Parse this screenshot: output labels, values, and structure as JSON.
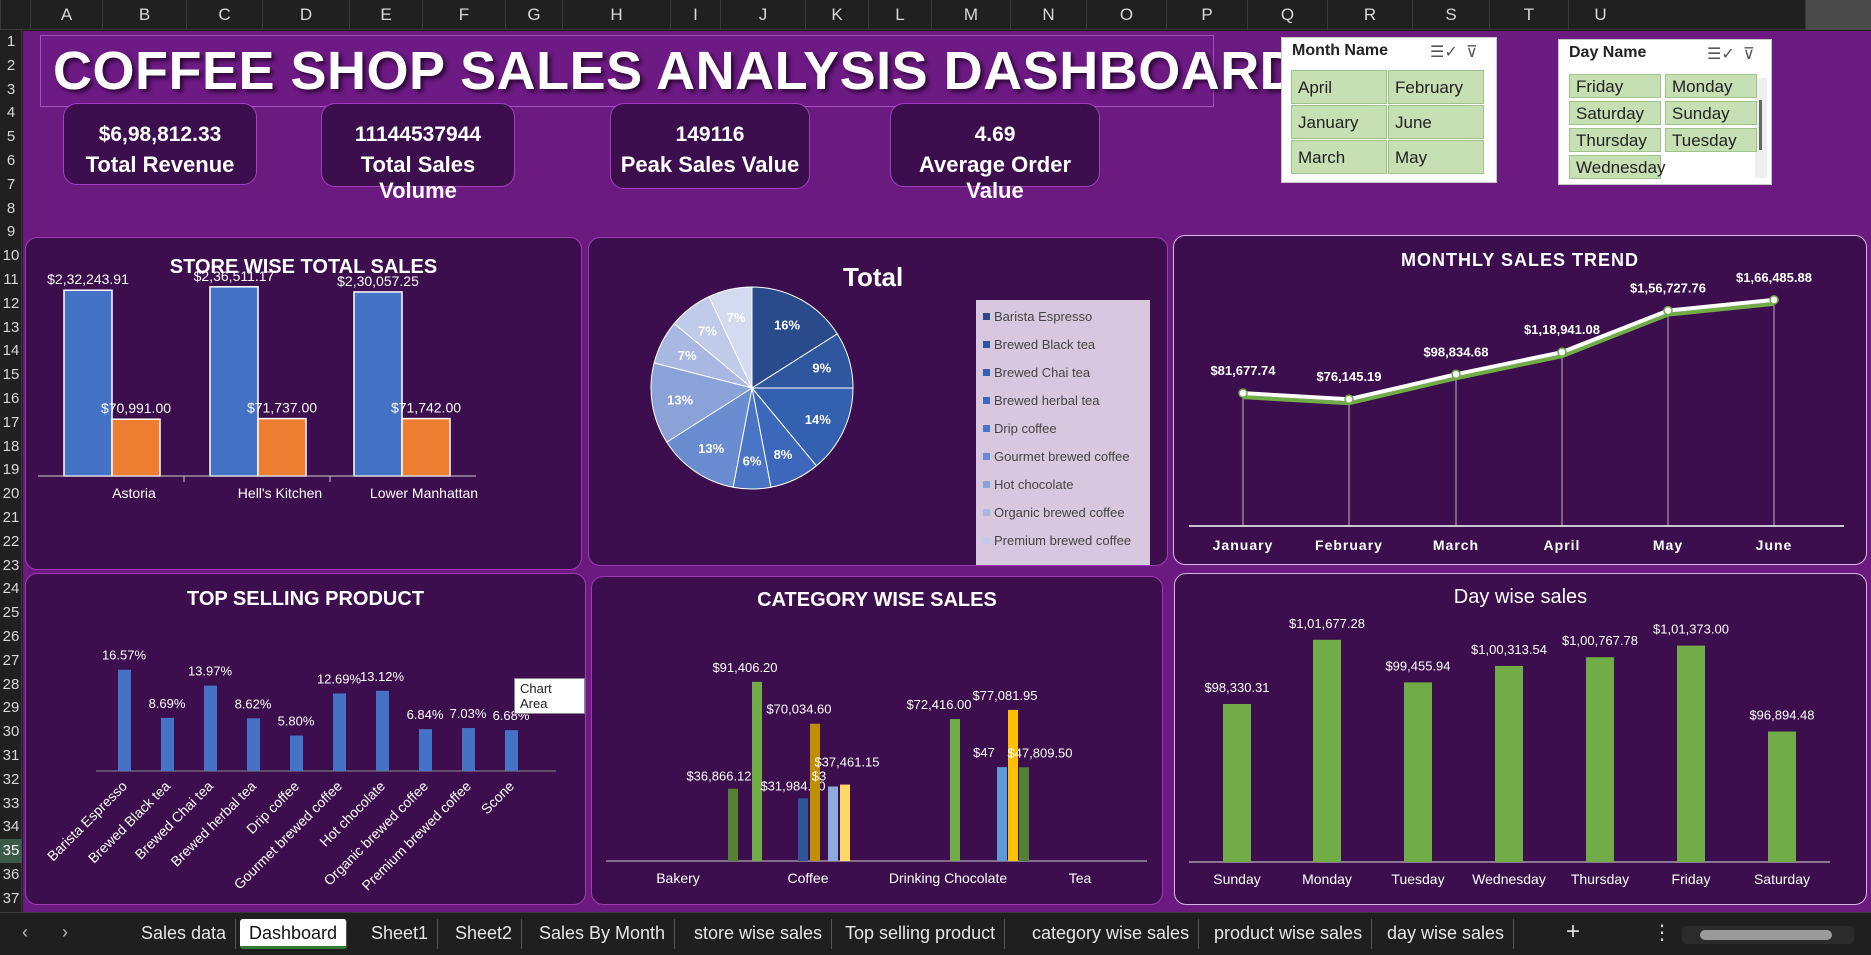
{
  "columns": [
    "A",
    "B",
    "C",
    "D",
    "E",
    "F",
    "G",
    "H",
    "I",
    "J",
    "K",
    "L",
    "M",
    "N",
    "O",
    "P",
    "Q",
    "R",
    "S",
    "T",
    "U"
  ],
  "rows": [
    "1",
    "2",
    "3",
    "4",
    "5",
    "6",
    "7",
    "8",
    "9",
    "10",
    "11",
    "12",
    "13",
    "14",
    "15",
    "16",
    "17",
    "18",
    "19",
    "20",
    "21",
    "22",
    "23",
    "24",
    "25",
    "26",
    "27",
    "28",
    "29",
    "30",
    "31",
    "32",
    "33",
    "34",
    "35",
    "36",
    "37"
  ],
  "selected_row": "35",
  "title": "COFFEE SHOP SALES ANALYSIS DASHBOARD",
  "kpis": [
    {
      "value": "$6,98,812.33",
      "label": "Total Revenue"
    },
    {
      "value": "11144537944",
      "label": "Total Sales Volume"
    },
    {
      "value": "149116",
      "label": "Peak Sales Value"
    },
    {
      "value": "4.69",
      "label": "Average Order Value"
    }
  ],
  "month_slicer": {
    "title": "Month Name",
    "items": [
      "April",
      "February",
      "January",
      "June",
      "March",
      "May"
    ]
  },
  "day_slicer": {
    "title": "Day Name",
    "items": [
      "Friday",
      "Monday",
      "Saturday",
      "Sunday",
      "Thursday",
      "Tuesday",
      "Wednesday"
    ]
  },
  "tooltip": "Chart Area",
  "chart_data": [
    {
      "type": "bar",
      "title": "STORE WISE TOTAL SALES",
      "categories": [
        "Astoria",
        "Hell's Kitchen",
        "Lower Manhattan"
      ],
      "series": [
        {
          "values": [
            232243.91,
            236511.17,
            230057.25
          ],
          "labels": [
            "$2,32,243.91",
            "$2,36,511.17",
            "$2,30,057.25"
          ],
          "color": "#4472c4"
        },
        {
          "values": [
            70991.0,
            71737.0,
            71742.0
          ],
          "labels": [
            "$70,991.00",
            "$71,737.00",
            "$71,742.00"
          ],
          "color": "#ed7d31"
        }
      ],
      "ylim": [
        0,
        250000
      ]
    },
    {
      "type": "pie",
      "title": "Total",
      "legend": [
        "Barista Espresso",
        "Brewed Black tea",
        "Brewed Chai tea",
        "Brewed herbal tea",
        "Drip coffee",
        "Gourmet brewed coffee",
        "Hot chocolate",
        "Organic brewed coffee",
        "Premium brewed coffee"
      ],
      "slices": [
        16,
        9,
        14,
        8,
        6,
        13,
        13,
        7,
        7,
        7
      ],
      "slice_labels": [
        "16%",
        "9%",
        "14%",
        "8%",
        "6%",
        "13%",
        "13%",
        "7%",
        "7%",
        "7%"
      ],
      "colors": [
        "#294b8c",
        "#2f57a0",
        "#3460b0",
        "#3c67bb",
        "#4a74c4",
        "#6a8cd0",
        "#8aa2d8",
        "#a8b8e2",
        "#c0cbea",
        "#d3dbf0"
      ],
      "legend_position": "right"
    },
    {
      "type": "line",
      "title": "MONTHLY SALES TREND",
      "categories": [
        "January",
        "February",
        "March",
        "April",
        "May",
        "June"
      ],
      "values": [
        81677.74,
        76145.19,
        98834.68,
        118941.08,
        156727.76,
        166485.88
      ],
      "labels": [
        "$81,677.74",
        "$76,145.19",
        "$98,834.68",
        "$1,18,941.08",
        "$1,56,727.76",
        "$1,66,485.88"
      ],
      "ylim": [
        40000,
        175000
      ]
    },
    {
      "type": "bar",
      "title": "TOP SELLING PRODUCT",
      "categories": [
        "Barista Espresso",
        "Brewed Black tea",
        "Brewed Chai tea",
        "Brewed herbal tea",
        "Drip coffee",
        "Gourmet brewed coffee",
        "Hot chocolate",
        "Organic brewed coffee",
        "Premium brewed coffee",
        "Scone"
      ],
      "values": [
        16.57,
        8.69,
        13.97,
        8.62,
        5.8,
        12.69,
        13.12,
        6.84,
        7.03,
        6.68
      ],
      "labels": [
        "16.57%",
        "8.69%",
        "13.97%",
        "8.62%",
        "5.80%",
        "12.69%",
        "13.12%",
        "6.84%",
        "7.03%",
        "6.68%"
      ],
      "ylim": [
        0,
        18
      ]
    },
    {
      "type": "bar",
      "title": "CATEGORY WISE SALES",
      "categories": [
        "Bakery",
        "Coffee",
        "Drinking Chocolate",
        "Tea"
      ],
      "groups": [
        {
          "category": "Bakery",
          "bars": [
            {
              "value": 36866.12,
              "label": "$36,866.12",
              "color": "#548235"
            },
            {
              "value": 91406.2,
              "label": "$91,406.20",
              "color": "#70ad47"
            }
          ]
        },
        {
          "category": "Coffee",
          "bars": [
            {
              "value": 31984.0,
              "label": "$31,984.00",
              "color": "#2f5597"
            },
            {
              "value": 70034.6,
              "label": "$70,034.60",
              "color": "#bf8f00"
            },
            {
              "value": 38000,
              "label": "$3",
              "color": "#8faadc"
            },
            {
              "value": 39000,
              "label": "$37,461.15",
              "color": "#ffd966"
            }
          ]
        },
        {
          "category": "Drinking Chocolate",
          "bars": [
            {
              "value": 72416.0,
              "label": "$72,416.00",
              "color": "#70ad47"
            }
          ]
        },
        {
          "category": "Tea",
          "bars": [
            {
              "value": 47900,
              "label": "$47",
              "color": "#5b9bd5"
            },
            {
              "value": 77081.95,
              "label": "$77,081.95",
              "color": "#ffc000"
            },
            {
              "value": 47800,
              "label": "$47,809.50",
              "color": "#548235"
            }
          ]
        }
      ],
      "ylim": [
        0,
        100000
      ]
    },
    {
      "type": "bar",
      "title": "Day wise sales",
      "categories": [
        "Sunday",
        "Monday",
        "Tuesday",
        "Wednesday",
        "Thursday",
        "Friday",
        "Saturday"
      ],
      "values": [
        98330.31,
        101677.28,
        99455.94,
        100313.54,
        100767.78,
        101373.0,
        96894.48
      ],
      "labels": [
        "$98,330.31",
        "$1,01,677.28",
        "$99,455.94",
        "$1,00,313.54",
        "$1,00,767.78",
        "$1,01,373.00",
        "$96,894.48"
      ],
      "ylim": [
        94000,
        102500
      ]
    }
  ],
  "tabs": [
    "Sales data",
    "Dashboard",
    "Sheet1",
    "Sheet2",
    "Sales By Month",
    "store wise sales",
    "Top selling product",
    "category wise sales",
    "product wise sales",
    "day wise sales"
  ],
  "active_tab": "Dashboard"
}
